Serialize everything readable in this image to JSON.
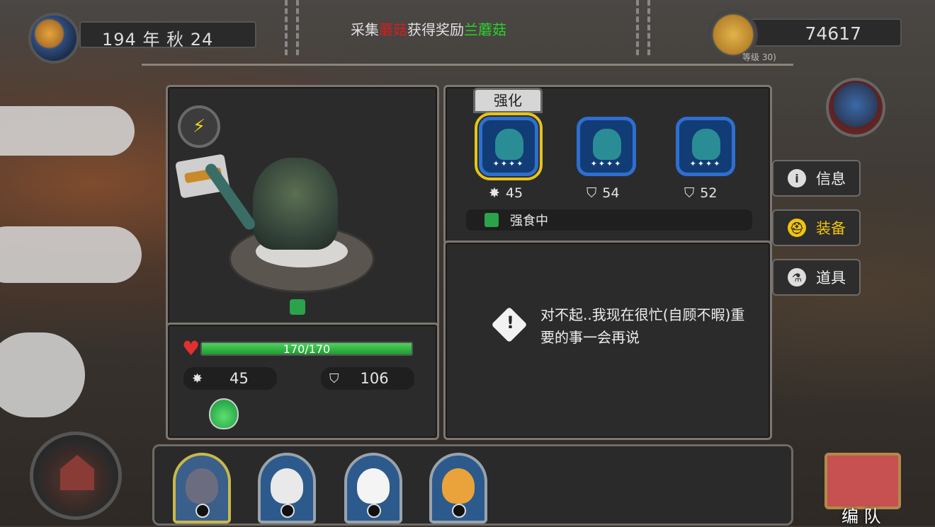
{
  "hud": {
    "date": "194 年 秋 24",
    "coins": "74617",
    "level_note": "等级 30)"
  },
  "notice": {
    "prefix": "采集",
    "item": "蘑菇",
    "mid": "获得奖励",
    "reward": "兰蘑菇"
  },
  "monster": {
    "hp_text": "170/170",
    "hp_current": 170,
    "hp_max": 170,
    "attack": "45",
    "defense": "106"
  },
  "equipment": {
    "enhance_label": "强化",
    "slots": [
      {
        "stars": "✦✦✦✦",
        "stat_icon": "attack-icon",
        "value": "45",
        "selected": true
      },
      {
        "stars": "✦✦✦✦",
        "stat_icon": "shield-icon",
        "value": "54",
        "selected": false
      },
      {
        "stars": "✦✦✦✦",
        "stat_icon": "shield-icon",
        "value": "52",
        "selected": false
      }
    ],
    "status": "强食中"
  },
  "message": {
    "text": "对不起..我现在很忙(自顾不暇)重要的事一会再说"
  },
  "side_menu": {
    "info": "信息",
    "equipment": "装备",
    "items": "道具"
  },
  "formation_label": "编 队",
  "colors": {
    "accent_yellow": "#f1c40f",
    "hp_green": "#2bb84a",
    "notice_red": "#d11f1f",
    "notice_green": "#2bd12b",
    "equip_blue": "#2e6fd0"
  }
}
